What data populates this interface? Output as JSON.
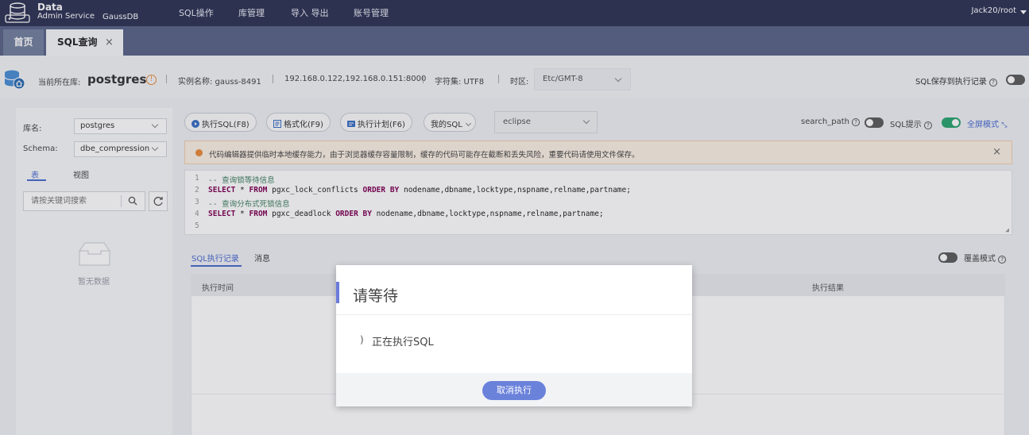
{
  "colors": {
    "nav_bg": "#2f3456",
    "tabbar_bg": "#5a6589",
    "accent": "#4a6bd1",
    "warning": "#e98b3b",
    "toggle_on": "#2aa56f",
    "modal_button": "#6b82db"
  },
  "topnav": {
    "logo_line1": "Data",
    "logo_line2": "Admin Service",
    "logo_line3": "GaussDB",
    "items": [
      "SQL操作",
      "库管理",
      "导入 导出",
      "账号管理"
    ],
    "user": "Jack20/root"
  },
  "tabs": {
    "home": "首页",
    "sql": "SQL查询",
    "close": "×"
  },
  "infobar": {
    "current_db_label": "当前所在库:",
    "current_db": "postgres",
    "instance": "实例名称: gauss-8491",
    "hosts": "192.168.0.122,192.168.0.151:8000",
    "charset": "字符集: UTF8",
    "timezone_label": "时区:",
    "timezone": "Etc/GMT-8",
    "save_history": "SQL保存到执行记录",
    "save_history_on": false
  },
  "left": {
    "db_label": "库名:",
    "db_value": "postgres",
    "schema_label": "Schema:",
    "schema_value": "dbe_compression",
    "tab_table": "表",
    "tab_view": "视图",
    "search_placeholder": "请按关键词搜索",
    "empty": "暂无数据"
  },
  "toolbar": {
    "run": "执行SQL(F8)",
    "format": "格式化(F9)",
    "plan": "执行计划(F6)",
    "my_sql": "我的SQL",
    "theme": "eclipse",
    "search_path": "search_path",
    "search_path_on": false,
    "sql_hint": "SQL提示",
    "sql_hint_on": true,
    "fullscreen": "全屏模式"
  },
  "notice": {
    "text": "代码编辑器提供临时本地缓存能力，由于浏览器缓存容量限制，缓存的代码可能存在截断和丢失风险，重要代码请使用文件保存。",
    "close": "×"
  },
  "editor": {
    "line_numbers": [
      "1",
      "2",
      "3",
      "4",
      "5"
    ],
    "line1": "-- 查询锁等待信息",
    "line2_a": "SELECT",
    "line2_b": " * ",
    "line2_c": "FROM",
    "line2_d": " pgxc_lock_conflicts ",
    "line2_e": "ORDER BY",
    "line2_f": " nodename,dbname,locktype,nspname,relname,partname;",
    "line3": "-- 查询分布式死锁信息",
    "line4_a": "SELECT",
    "line4_b": " * ",
    "line4_c": "FROM",
    "line4_d": " pgxc_deadlock ",
    "line4_e": "ORDER BY",
    "line4_f": " nodename,dbname,locktype,nspname,relname,partname;"
  },
  "results": {
    "tab_history": "SQL执行记录",
    "tab_messages": "消息",
    "overlay_mode": "覆盖模式",
    "overlay_on": false,
    "col_time": "执行时间",
    "col_result": "执行结果"
  },
  "modal": {
    "title": "请等待",
    "spinner": ")",
    "message": "正在执行SQL",
    "cancel": "取消执行"
  }
}
